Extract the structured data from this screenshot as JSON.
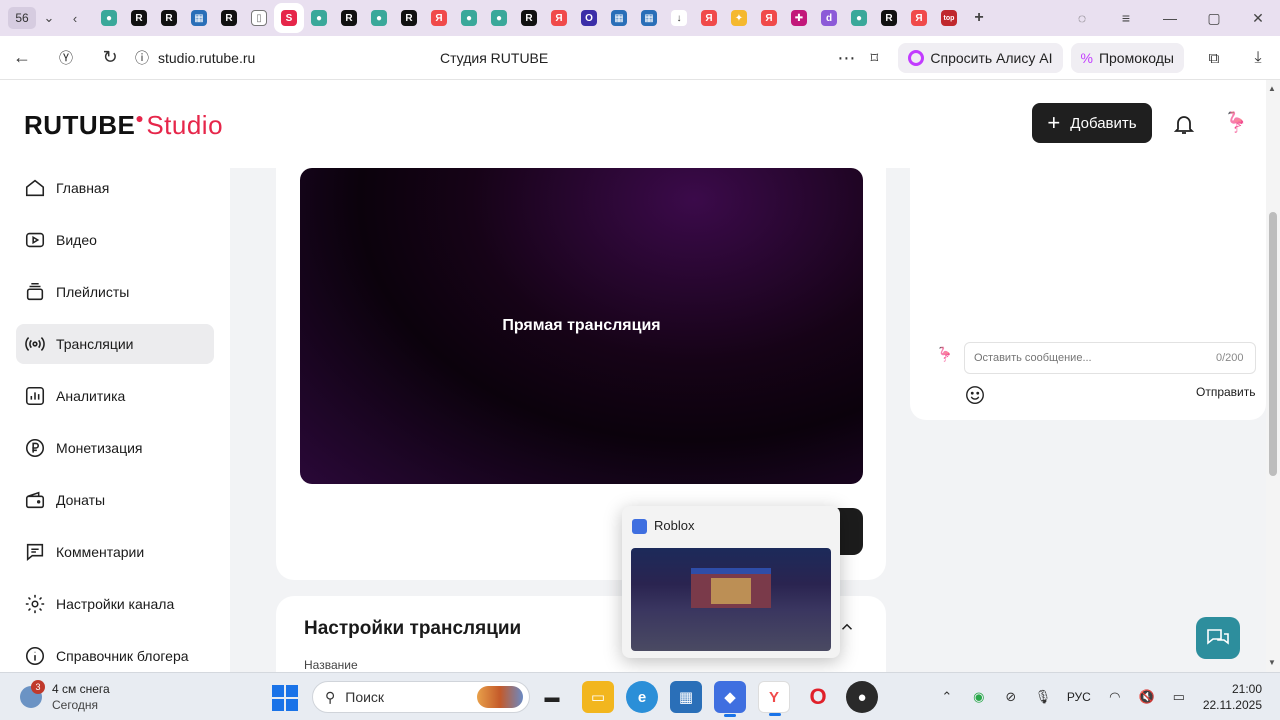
{
  "browser": {
    "tab_count": "56",
    "url": "studio.rutube.ru",
    "page_title": "Студия RUTUBE",
    "alice_label": "Спросить Алису AI",
    "promo_label": "Промокоды"
  },
  "header": {
    "logo_main": "RUTUBE",
    "logo_studio": "Studio",
    "add_label": "Добавить"
  },
  "sidebar": {
    "items": [
      {
        "label": "Главная"
      },
      {
        "label": "Видео"
      },
      {
        "label": "Плейлисты"
      },
      {
        "label": "Трансляции"
      },
      {
        "label": "Аналитика"
      },
      {
        "label": "Монетизация"
      },
      {
        "label": "Донаты"
      },
      {
        "label": "Комментарии"
      },
      {
        "label": "Настройки канала"
      },
      {
        "label": "Справочник блогера"
      }
    ]
  },
  "player": {
    "status_text": "Прямая трансляция"
  },
  "chat": {
    "placeholder": "Оставить сообщение...",
    "counter": "0/200",
    "send_label": "Отправить"
  },
  "settings": {
    "title": "Настройки трансляции",
    "name_label": "Название"
  },
  "preview": {
    "title": "Roblox"
  },
  "taskbar": {
    "weather_badge": "3",
    "weather_line1": "4 см снега",
    "weather_line2": "Сегодня",
    "search_label": "Поиск",
    "lang": "РУС",
    "time": "21:00",
    "date": "22.11.2025"
  },
  "colors": {
    "brand_red": "#e6264a",
    "help_fab": "#2d8e9d",
    "dark_button": "#1f1f1f"
  }
}
